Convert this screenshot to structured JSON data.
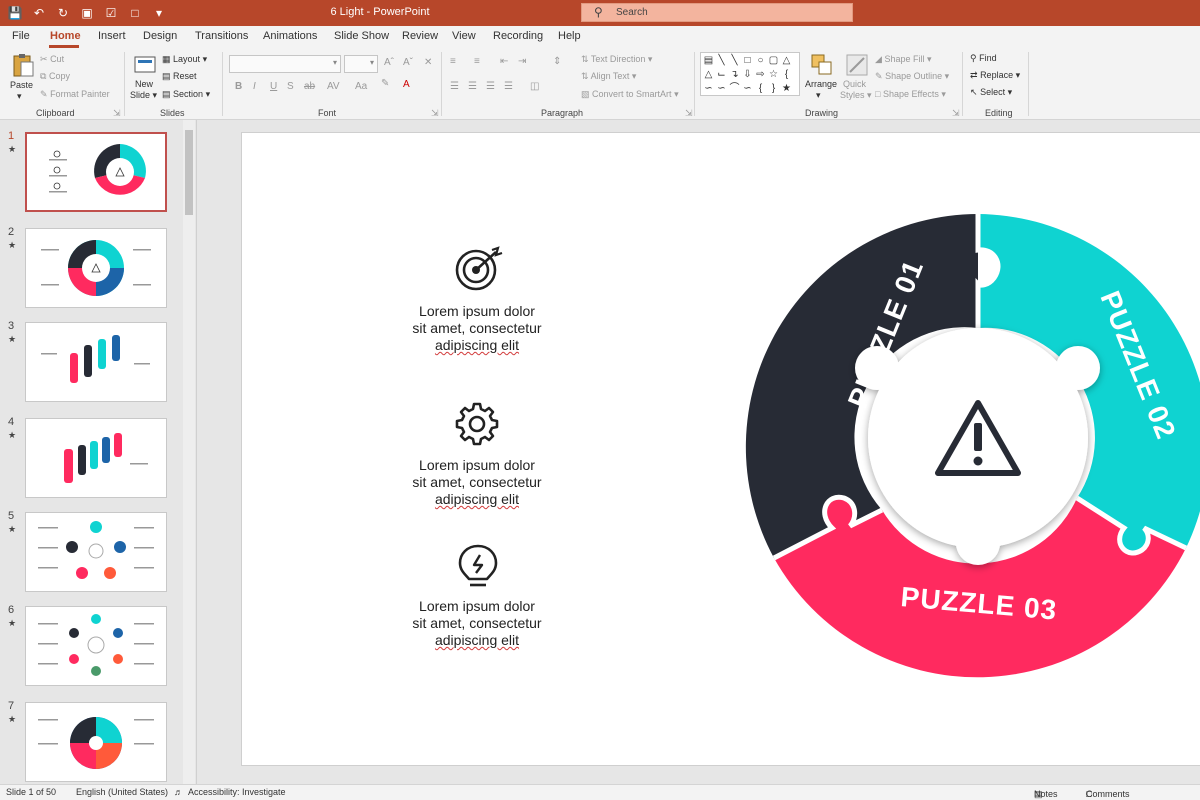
{
  "window": {
    "title": "6 Light  -  PowerPoint",
    "search_placeholder": "Search"
  },
  "tabs": [
    "File",
    "Home",
    "Insert",
    "Design",
    "Transitions",
    "Animations",
    "Slide Show",
    "Review",
    "View",
    "Recording",
    "Help"
  ],
  "ribbon": {
    "clipboard": {
      "paste": "Paste",
      "cut": "Cut",
      "copy": "Copy",
      "format_painter": "Format Painter",
      "label": "Clipboard"
    },
    "slides": {
      "new_slide": "New",
      "new_slide2": "Slide",
      "layout": "Layout",
      "reset": "Reset",
      "section": "Section",
      "label": "Slides"
    },
    "font": {
      "label": "Font",
      "buttons": [
        "B",
        "I",
        "U",
        "S",
        "ab",
        "AV",
        "Aa"
      ]
    },
    "paragraph": {
      "text_direction": "Text Direction",
      "align_text": "Align Text",
      "convert_smartart": "Convert to SmartArt",
      "label": "Paragraph"
    },
    "drawing": {
      "arrange": "Arrange",
      "quick_styles": "Quick",
      "quick_styles2": "Styles",
      "shape_fill": "Shape Fill",
      "shape_outline": "Shape Outline",
      "shape_effects": "Shape Effects",
      "label": "Drawing"
    },
    "editing": {
      "find": "Find",
      "replace": "Replace",
      "select": "Select",
      "label": "Editing"
    }
  },
  "thumbnails": [
    {
      "num": "1",
      "star": "★"
    },
    {
      "num": "2",
      "star": "★"
    },
    {
      "num": "3",
      "star": "★"
    },
    {
      "num": "4",
      "star": "★"
    },
    {
      "num": "5",
      "star": "★"
    },
    {
      "num": "6",
      "star": "★"
    },
    {
      "num": "7",
      "star": "★"
    }
  ],
  "slide": {
    "items": [
      {
        "icon": "target-icon",
        "line1": "Lorem ipsum dolor",
        "line2": "sit amet, consectetur",
        "line3": "adipiscing elit"
      },
      {
        "icon": "gear-icon",
        "line1": "Lorem ipsum dolor",
        "line2": "sit amet, consectetur",
        "line3": "adipiscing elit"
      },
      {
        "icon": "lightbulb-icon",
        "line1": "Lorem ipsum dolor",
        "line2": "sit amet, consectetur",
        "line3": "adipiscing elit"
      }
    ],
    "puzzle": {
      "piece1": "PUZZLE 01",
      "piece2": "PUZZLE 02",
      "piece3": "PUZZLE 03",
      "colors": {
        "piece1": "#272b35",
        "piece2": "#0fd3d1",
        "piece3": "#ff2a5f"
      }
    }
  },
  "status": {
    "slide_info": "Slide 1 of 50",
    "language": "English (United States)",
    "accessibility": "Accessibility: Investigate",
    "notes": "Notes",
    "comments": "Comments"
  }
}
